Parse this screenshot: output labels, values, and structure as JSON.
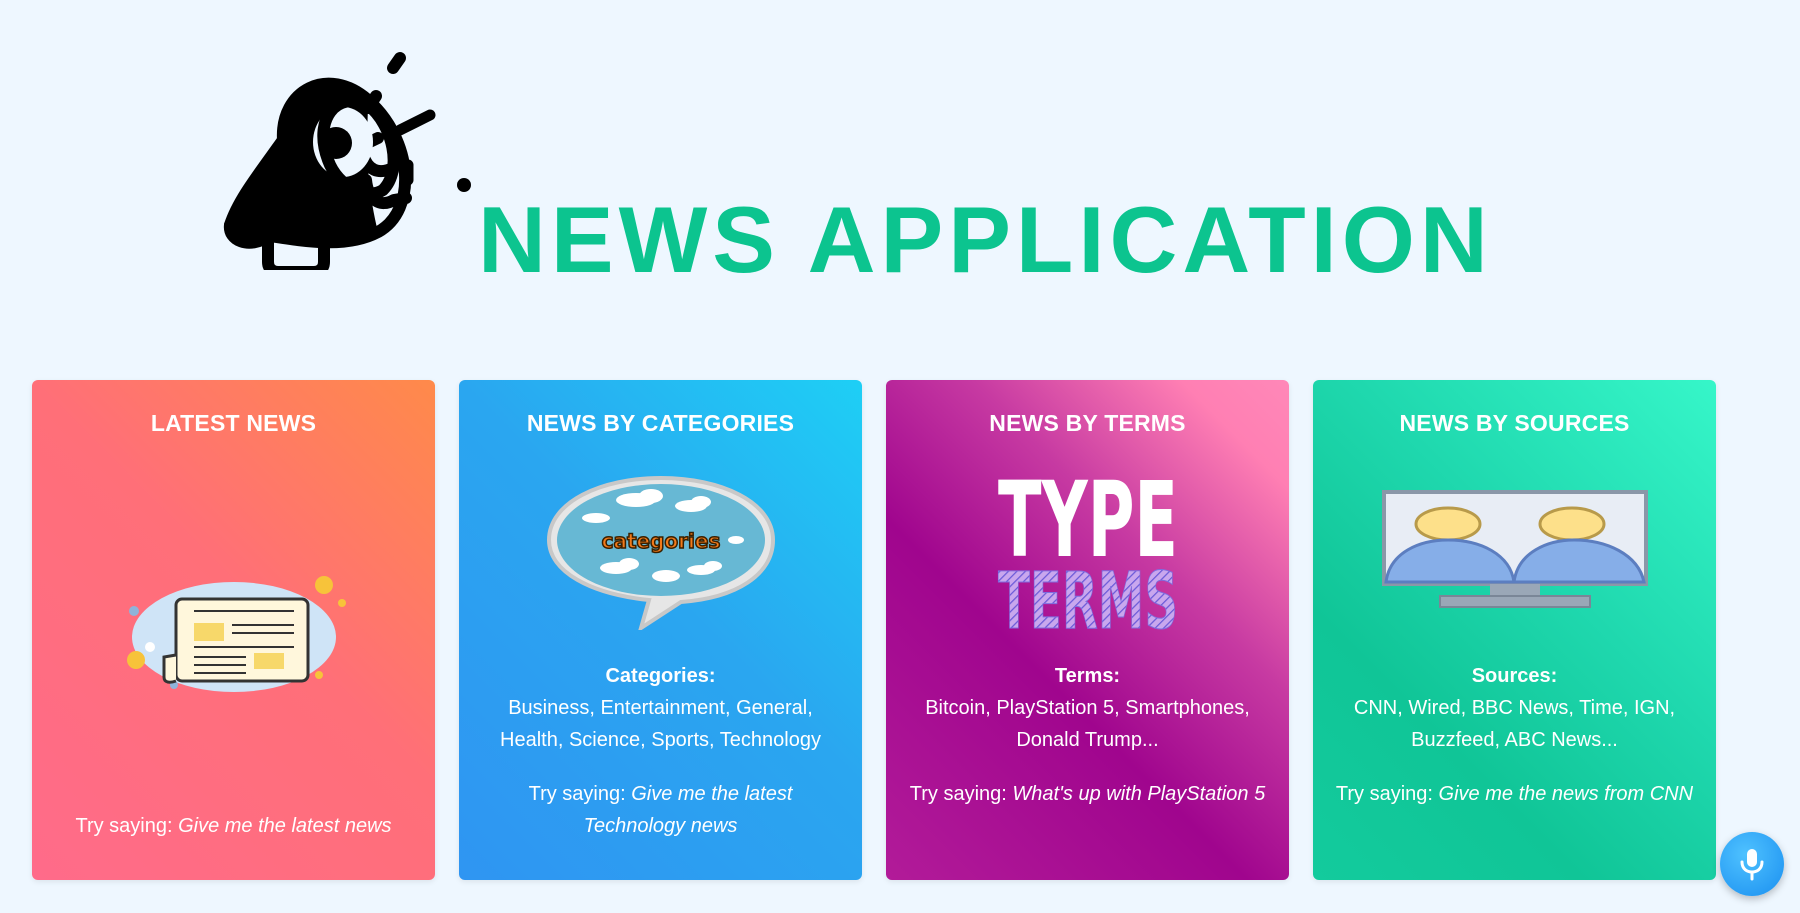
{
  "app": {
    "title": "NEWS APPLICATION"
  },
  "colors": {
    "title": "#0cc48f",
    "background": "#eef7ff"
  },
  "cards": [
    {
      "title": "LATEST NEWS",
      "image": "newspaper-illustration",
      "info_label": "",
      "info_text": "",
      "try_prefix": "Try saying:",
      "try_phrase": "Give me the latest news"
    },
    {
      "title": "NEWS BY CATEGORIES",
      "image": "categories-speech-bubble",
      "image_text": "categories",
      "info_label": "Categories:",
      "info_text": "Business, Entertainment, General, Health, Science, Sports, Technology",
      "try_prefix": "Try saying:",
      "try_phrase": "Give me the latest Technology news"
    },
    {
      "title": "NEWS BY TERMS",
      "image": "type-terms-text",
      "image_line1": "TYPE",
      "image_line2": "TERMS",
      "info_label": "Terms:",
      "info_text": "Bitcoin, PlayStation 5, Smartphones, Donald Trump...",
      "try_prefix": "Try saying:",
      "try_phrase": "What's up with PlayStation 5"
    },
    {
      "title": "NEWS BY SOURCES",
      "image": "monitor-people-icon",
      "info_label": "Sources:",
      "info_text": "CNN, Wired, BBC News, Time, IGN, Buzzfeed, ABC News...",
      "try_prefix": "Try saying:",
      "try_phrase": "Give me the news from CNN"
    }
  ],
  "mic_button": {
    "icon": "microphone-icon"
  }
}
